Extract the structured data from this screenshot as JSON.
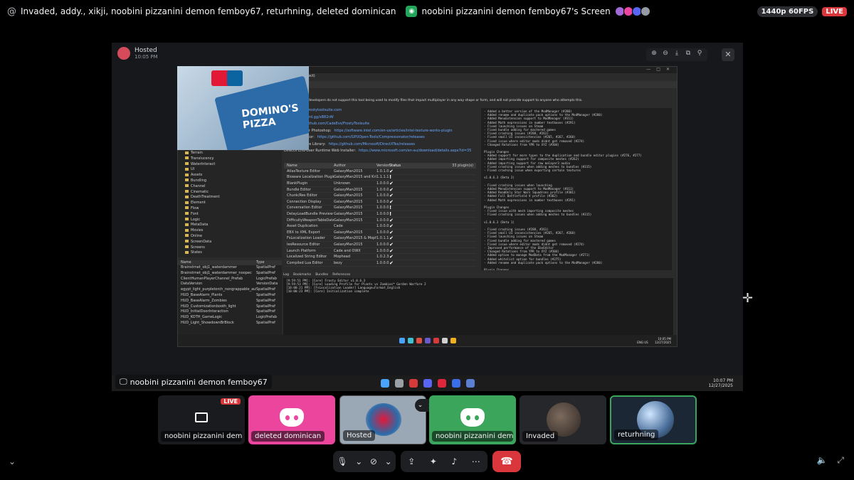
{
  "topbar": {
    "channel_prefix": "@",
    "title": "Invaded, addy., xikji, noobini pizzanini demon femboy67, returhning, deleted dominican",
    "stream_title": "noobini pizzanini demon femboy67's Screen",
    "quality": "1440p 60FPS",
    "live": "LIVE",
    "avatar_colors": [
      "#a26ad8",
      "#eb459e",
      "#5865f2",
      "#949ba4"
    ]
  },
  "stream": {
    "host_name": "Hosted",
    "host_time": "10:05 PM",
    "tooltip_name": "noobini pizzanini demon femboy67",
    "dominos_text": "DOMINO'S PIZZA",
    "host_taskbar_time": "10:07 PM",
    "host_taskbar_date": "12/27/2025"
  },
  "app": {
    "window_title": "ect)",
    "warning": "developers do not support this tool being used to modify files that impact multiplayer in any way shape or form, and will not provide support to anyone who attempts this.",
    "links": [
      {
        "label": "",
        "url": "http://www.frostytoolsuite.com"
      },
      {
        "label": "",
        "url": "https://discord.gg/xB82rAf"
      },
      {
        "label": "ub:",
        "url": "https://github.com/CadeEvs/FrostyToolsuite"
      },
      {
        "label": "ooks Plugin for Photoshop:",
        "url": "https://software.intel.com/en-us/articles/intel-texture-works-plugin"
      },
      {
        "label": "Compressonator:",
        "url": "https://github.com/GPUOpen-Tools/Compressonator/releases"
      },
      {
        "label": "DirectX Texture Library:",
        "url": "https://github.com/Microsoft/DirectXTex/releases"
      },
      {
        "label": "DirectX End-User Runtime Web Installer:",
        "url": "https://www.microsoft.com/en-au/download/details.aspx?id=35"
      }
    ],
    "plugin_headers": [
      "Name",
      "Author",
      "Version",
      "Status"
    ],
    "plugin_count": "33 plugin(s)",
    "plugins": [
      [
        "AtlasTexture Editor",
        "GalaxyMan2015",
        "1.0.1.0",
        "✔"
      ],
      [
        "Bioware Localization Plugin",
        "GalaxyMan2015 and Krifa",
        "1.1.1.1",
        "!"
      ],
      [
        "BlankPlugin",
        "Unknown",
        "1.0.0.0",
        "✔"
      ],
      [
        "Bundle Editor",
        "GalaxyMan2015",
        "1.0.0.0",
        "✔"
      ],
      [
        "Chunk/Res Editor",
        "GalaxyMan2015",
        "1.0.0.0",
        "✔"
      ],
      [
        "Connection Display",
        "GalaxyMan2015",
        "1.0.0.0",
        "✔"
      ],
      [
        "Conversation Editor",
        "GalaxyMan2015",
        "1.0.0.0",
        "!"
      ],
      [
        "DelayLoadBundle Preview",
        "GalaxyMan2015",
        "1.0.0.0",
        "!"
      ],
      [
        "DifficultyWeaponTableDataPlugin",
        "GalaxyMan2015",
        "1.0.0.0",
        "✔"
      ],
      [
        "Asset Duplication",
        "Cade",
        "1.0.0.0",
        "✔"
      ],
      [
        "EBX to XML Export",
        "GalaxyMan2015",
        "1.0.0.0",
        "✔"
      ],
      [
        "FsLocalization Loader",
        "GalaxyMan2015 & Mophead",
        "1.0.1.1",
        "✔"
      ],
      [
        "IesResource Editor",
        "GalaxyMan2015",
        "1.0.0.0",
        "✔"
      ],
      [
        "Launch Platform",
        "Cade and OWX",
        "1.0.0.0",
        "✔"
      ],
      [
        "Localized String Editor",
        "Mophead",
        "1.0.2.3",
        "✔"
      ],
      [
        "Compiled Lua Editor",
        "bezy",
        "1.0.0.0",
        "✔"
      ]
    ],
    "changelog": [
      "- Added a better version of the ModManager (#280)",
      "- Added rename and duplicate pack options to the ModManager (#280)",
      "- Added MenuExtension support to ModManager (#311)",
      "- Added Math expressions in number textboxes (#291)",
      "- Fixed launching issues on Steam",
      "- Fixed bundle adding for mastered games",
      "- Fixed crashing issues (#288, #261)",
      "- Fixed small UI inconsistencies (#265, #267, #268)",
      "- Fixed issue where editor mods didnt get removed (#274)",
      "- Changed Rotations from YPR to XYZ (#304)",
      "",
      "Plugin Changes",
      "- Added support for more types to the duplication and bundle editor plugins (#276, #277)",
      "- Added importing support for composite meshes (#262)",
      "- Added importing support for raw malayer3 audio",
      "- Fixed crashing issues when adding meshes to bundles (#315)",
      "- Fixed crashing issue when exporting certain textures",
      "",
      "v1.0.6.3 (Beta 2)",
      "",
      "- Fixed crashing issues when launching",
      "- Added MenuExtension support to ModManager (#311)",
      "- Added ReadOnly Star Wars Squadrons profile (#301)",
      "- Added Full Battlefield V profile (#302)",
      "- Added Math expressions in number textboxes (#291)",
      "",
      "Plugin Changes",
      "- Fixed issue with mesh importing composite meshes",
      "- Fixed crashing issues when adding meshes to bundles (#315)",
      "",
      "v1.0.6.3 (Beta 1)",
      "",
      "- Fixed crashing issues (#288, #261)",
      "- Fixed small UI inconsistencies (#265, #267, #268)",
      "- Fixed launching issues on Steam",
      "- Fixed bundle adding for mastered games",
      "- Fixed issue where editor mods didnt get removed (#274)",
      "- Improved performance of the EbxEditor",
      "- Changed Rotations from YPR to XYZ (#304)",
      "- Added option to manage ModData from the ModManager (#271)",
      "- Added whitelist option for bundles (#275)",
      "- Added rename and duplicate pack options to the ModManager (#280)",
      "",
      "Plugin Changes"
    ],
    "tree": [
      "Terrain",
      "Translucency",
      "WaterInteract",
      "UI",
      "Assets",
      "Bundling",
      "Channel",
      "Cinematic",
      "DeathTreatment",
      "Element",
      "Flow",
      "Font",
      "Logic",
      "MetaData",
      "Movies",
      "Online",
      "ScreenData",
      "Screens",
      "States"
    ],
    "asset_headers": [
      "Name",
      "Type"
    ],
    "assets": [
      [
        "Brainstrnet_obj1_waterdammer",
        "SpatialPref"
      ],
      [
        "Brainstrnet_obj1_waterdammer_noopec",
        "SpatialPref"
      ],
      [
        "ClientHumanPlayerChannel_Prefab",
        "LogicPrefab"
      ],
      [
        "DataVersion",
        "VersionData"
      ],
      [
        "egypt_light_purpletorch_nongrappable_autogen",
        "SpatialPref"
      ],
      [
        "HUD_BaseAlarm_Plants",
        "SpatialPref"
      ],
      [
        "HUD_BaseAlarm_Zombies",
        "SpatialPref"
      ],
      [
        "HUD_Customizationbooth_light",
        "SpatialPref"
      ],
      [
        "HUD_InitialDoorInteraction",
        "SpatialPref"
      ],
      [
        "HUD_KOTH_GameLogic",
        "LogicPrefab"
      ],
      [
        "HUD_Light_ShowdownBrBlock",
        "SpatialPref"
      ]
    ],
    "log_tabs": [
      "Log",
      "Bookmarks",
      "Bundles",
      "References"
    ],
    "log_lines": [
      "[9:59:51 PM]: [Core] Frosty Editor v1.0.6.3",
      "[9:59:53 PM]: [Core] Loading Profile for Plants vs Zombies™ Garden Warfare 2",
      "[10:00:21 PM]: [FsLocalization Loader] Language=Format_English",
      "[10:00:23 PM]: [Core] Initialization complete"
    ],
    "taskbar_time": "10:05 PM",
    "taskbar_date": "12/27/2025",
    "taskbar_lang": "ENG US"
  },
  "tiles": [
    {
      "label": "noobini pizzanini demon ...",
      "live": "LIVE"
    },
    {
      "label": "deleted dominican"
    },
    {
      "label": "Hosted"
    },
    {
      "label": "noobini pizzanini demon fe..."
    },
    {
      "label": "Invaded"
    },
    {
      "label": "returhning"
    }
  ],
  "controls": {
    "mic": "mic-icon",
    "camera": "camera-off-icon",
    "share": "screen-share-icon",
    "activities": "activities-icon",
    "soundboard": "soundboard-icon",
    "more": "more-icon",
    "hangup": "hangup-icon"
  }
}
